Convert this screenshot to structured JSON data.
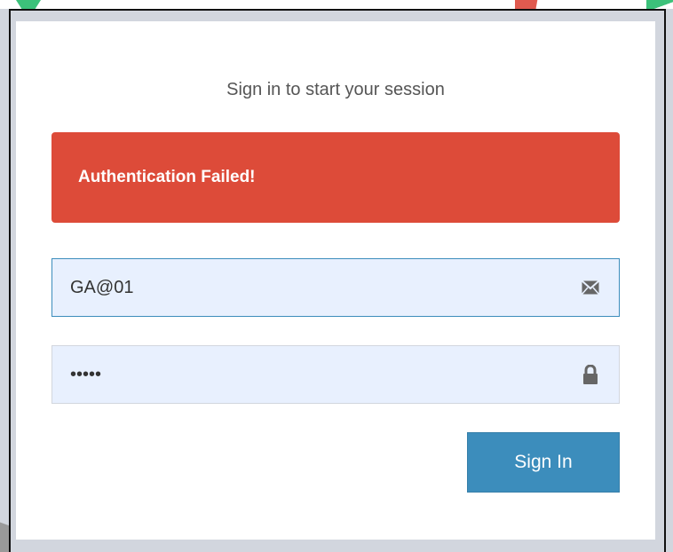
{
  "login": {
    "message": "Sign in to start your session",
    "alert_text": "Authentication Failed!",
    "username_value": "GA@01",
    "password_value": "•••••",
    "submit_label": "Sign In"
  },
  "icons": {
    "username": "envelope-icon",
    "password": "lock-icon"
  },
  "colors": {
    "alert_bg": "#dd4b39",
    "button_bg": "#3c8dbc",
    "page_bg": "#d2d6de"
  }
}
